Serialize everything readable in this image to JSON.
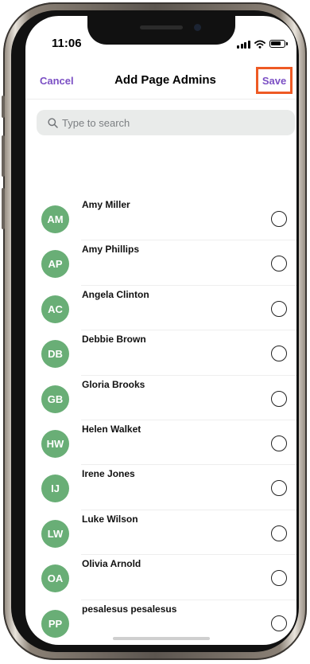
{
  "status_bar": {
    "time": "11:06"
  },
  "header": {
    "cancel_label": "Cancel",
    "title": "Add Page Admins",
    "save_label": "Save"
  },
  "search": {
    "placeholder": "Type to search",
    "value": ""
  },
  "admins": [
    {
      "initials": "AM",
      "name": "Amy Miller"
    },
    {
      "initials": "AP",
      "name": "Amy Phillips"
    },
    {
      "initials": "AC",
      "name": "Angela Clinton"
    },
    {
      "initials": "DB",
      "name": "Debbie Brown"
    },
    {
      "initials": "GB",
      "name": "Gloria Brooks"
    },
    {
      "initials": "HW",
      "name": "Helen Walket"
    },
    {
      "initials": "IJ",
      "name": "Irene Jones"
    },
    {
      "initials": "LW",
      "name": "Luke Wilson"
    },
    {
      "initials": "OA",
      "name": "Olivia Arnold"
    },
    {
      "initials": "PP",
      "name": "pesalesus pesalesus"
    }
  ],
  "icons": {
    "search": "search-icon",
    "select": "radio-circle-icon",
    "status": [
      "signal-icon",
      "wifi-icon",
      "battery-icon"
    ]
  },
  "colors": {
    "accent": "#7b4fc4",
    "avatar": "#69ae76",
    "highlight": "#ee5a24",
    "search_bg": "#e9ebea"
  }
}
